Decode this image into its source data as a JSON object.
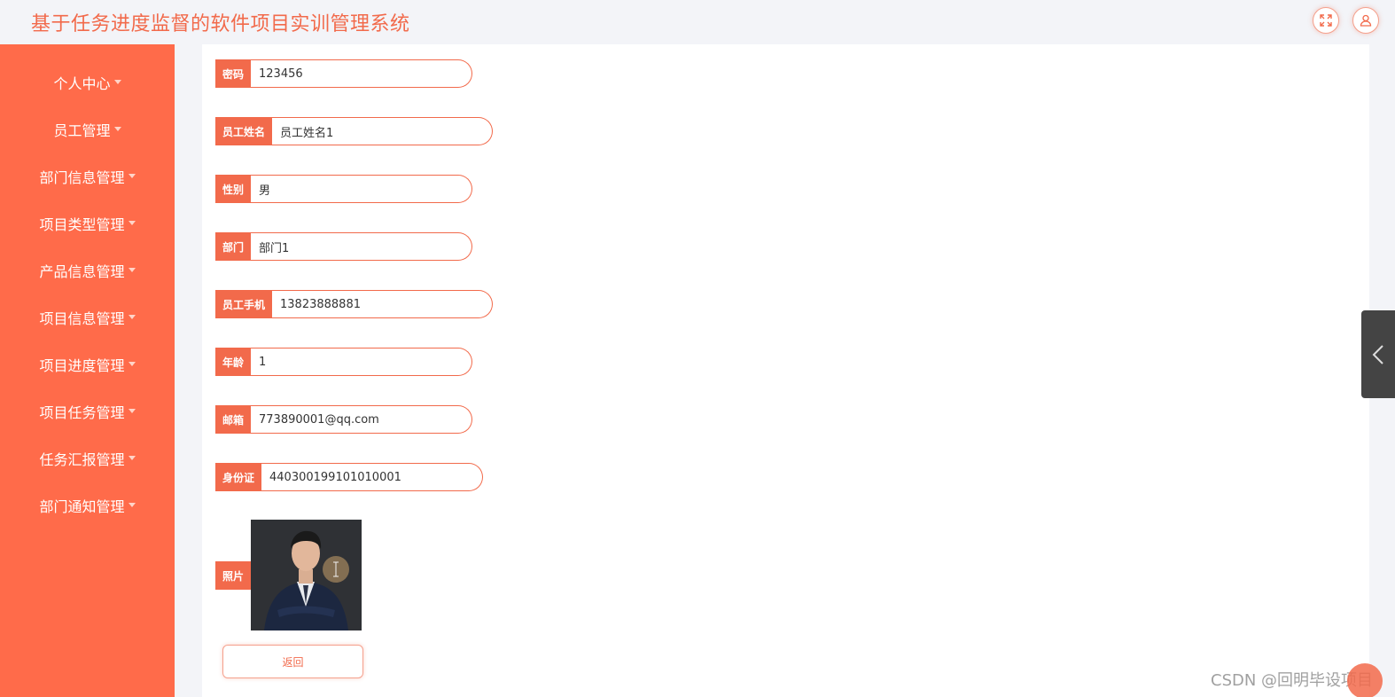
{
  "header": {
    "title": "基于任务进度监督的软件项目实训管理系统",
    "fullscreen_icon": "expand-icon",
    "user_icon": "user-icon"
  },
  "sidebar": {
    "items": [
      {
        "label": "个人中心"
      },
      {
        "label": "员工管理"
      },
      {
        "label": "部门信息管理"
      },
      {
        "label": "项目类型管理"
      },
      {
        "label": "产品信息管理"
      },
      {
        "label": "项目信息管理"
      },
      {
        "label": "项目进度管理"
      },
      {
        "label": "项目任务管理"
      },
      {
        "label": "任务汇报管理"
      },
      {
        "label": "部门通知管理"
      }
    ]
  },
  "form": {
    "fields": [
      {
        "label": "密码",
        "value": "123456"
      },
      {
        "label": "员工姓名",
        "value": "员工姓名1"
      },
      {
        "label": "性别",
        "value": "男"
      },
      {
        "label": "部门",
        "value": "部门1"
      },
      {
        "label": "员工手机",
        "value": "13823888881"
      },
      {
        "label": "年龄",
        "value": "1"
      },
      {
        "label": "邮箱",
        "value": "773890001@qq.com"
      },
      {
        "label": "身份证",
        "value": "440300199101010001"
      }
    ],
    "photo_label": "照片",
    "back_label": "返回"
  },
  "watermark": "CSDN @回明毕设项目",
  "colors": {
    "accent": "#f26a4b",
    "sidebar": "#ff6b4a",
    "background": "#f3f4f8"
  }
}
